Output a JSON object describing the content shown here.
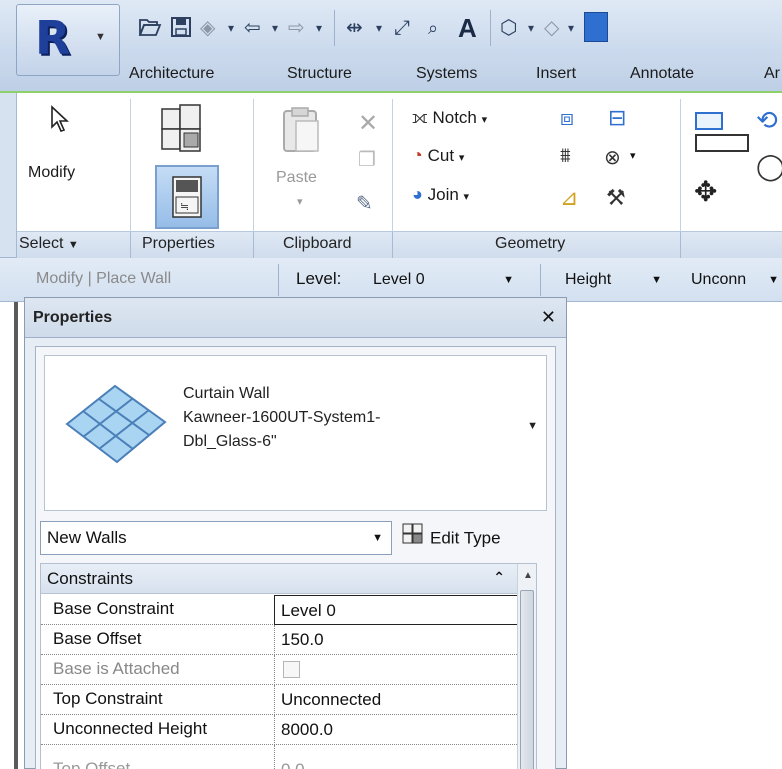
{
  "ribbon": {
    "tabs": [
      "Architecture",
      "Structure",
      "Systems",
      "Insert",
      "Annotate",
      "Ar"
    ],
    "select": {
      "modify_label": "Modify",
      "properties_label": "Properties",
      "panel_labels": [
        "Select",
        "Properties",
        "Clipboard",
        "Geometry"
      ]
    },
    "clipboard": {
      "paste_label": "Paste"
    },
    "geometry": {
      "notch_label": "Notch",
      "cut_label": "Cut",
      "join_label": "Join"
    }
  },
  "options_bar": {
    "context_label": "Modify | Place Wall",
    "level_label": "Level:",
    "level_value": "Level 0",
    "height_value": "Height",
    "unconnected_value": "Unconn"
  },
  "properties": {
    "title": "Properties",
    "type_family": "Curtain Wall",
    "type_name_line1": "Kawneer-1600UT-System1-",
    "type_name_line2": "Dbl_Glass-6\"",
    "instance_filter": "New Walls",
    "edit_type_label": "Edit Type",
    "group": "Constraints",
    "rows": [
      {
        "name": "Base Constraint",
        "value": "Level 0"
      },
      {
        "name": "Base Offset",
        "value": "150.0"
      },
      {
        "name": "Base is Attached",
        "value": ""
      },
      {
        "name": "Top Constraint",
        "value": "Unconnected"
      },
      {
        "name": "Unconnected Height",
        "value": "8000.0"
      },
      {
        "name": "Top Offset",
        "value": "0.0"
      }
    ]
  },
  "colors": {
    "ribbon_accent": "#8ed06a",
    "app_button_r": "#1e3f9a",
    "ribbon_bg": "#dfe9f5"
  }
}
